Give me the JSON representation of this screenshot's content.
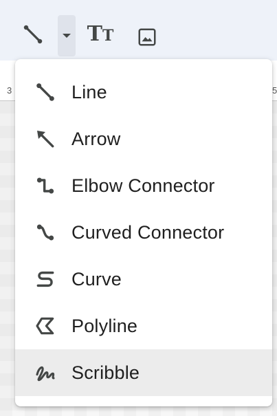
{
  "toolbar": {
    "text_tool_glyph": "TT",
    "icons": [
      "line-icon",
      "chevron-down-icon",
      "text-size-icon",
      "image-icon"
    ]
  },
  "ruler": {
    "left_number": "3",
    "right_number": "5"
  },
  "menu": {
    "items": [
      {
        "label": "Line",
        "icon": "line-icon"
      },
      {
        "label": "Arrow",
        "icon": "arrow-icon"
      },
      {
        "label": "Elbow Connector",
        "icon": "elbow-connector-icon"
      },
      {
        "label": "Curved Connector",
        "icon": "curved-connector-icon"
      },
      {
        "label": "Curve",
        "icon": "curve-icon"
      },
      {
        "label": "Polyline",
        "icon": "polyline-icon"
      },
      {
        "label": "Scribble",
        "icon": "scribble-icon",
        "highlighted": true
      }
    ]
  },
  "colors": {
    "toolbar_bg": "#eef2f9",
    "icon": "#444746",
    "text": "#1f1f1f",
    "highlight": "#ececec"
  }
}
